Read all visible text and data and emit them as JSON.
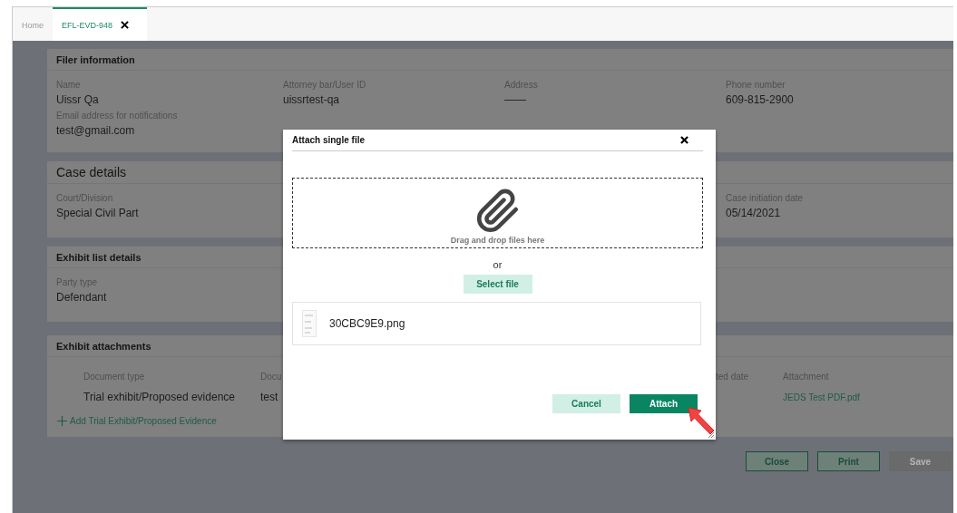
{
  "tabs": [
    {
      "label": "Home",
      "selected": false
    },
    {
      "label": "EFL-EVD-948",
      "selected": true
    }
  ],
  "filer_information": {
    "title": "Filer information",
    "rows": [
      [
        {
          "label": "Name",
          "value": "Uissr Qa"
        },
        {
          "label": "Attorney bar/User ID",
          "value": "uissrtest-qa"
        },
        {
          "label": "Address",
          "value": "——"
        },
        {
          "label": "Phone number",
          "value": "609-815-2900"
        }
      ],
      [
        {
          "label": "Email address for notifications",
          "value": "test@gmail.com"
        }
      ]
    ]
  },
  "case_details": {
    "title": "Case details",
    "court": {
      "label": "Court/Division",
      "value": "Special Civil Part"
    },
    "initiation": {
      "label": "Case initiation date",
      "value": "05/14/2021"
    }
  },
  "exhibit_list_details": {
    "title": "Exhibit list details",
    "party": {
      "label": "Party type",
      "value": "Defendant"
    }
  },
  "exhibit_attachments": {
    "title": "Exhibit attachments",
    "columns": {
      "document_type": "Document type",
      "column_2": "Docu",
      "column_4": "ted date",
      "attachment": "Attachment"
    },
    "rows": [
      {
        "document_type": "Trial exhibit/Proposed evidence",
        "column_2": "test",
        "attachment": "JEDS Test PDF.pdf"
      }
    ],
    "add_link": "Add Trial Exhibit/Proposed Evidence"
  },
  "footer_buttons": [
    {
      "label": "Close",
      "disabled": false
    },
    {
      "label": "Print",
      "disabled": false
    },
    {
      "label": "Save",
      "disabled": true
    }
  ],
  "modal": {
    "title": "Attach single file",
    "dropzone_text": "Drag and drop files here",
    "or_text": "or",
    "select_button": "Select file",
    "files": [
      {
        "name": "30CBC9E9.png"
      }
    ],
    "buttons": [
      {
        "label": "Cancel",
        "kind": "secondary"
      },
      {
        "label": "Attach",
        "kind": "primary"
      }
    ]
  }
}
